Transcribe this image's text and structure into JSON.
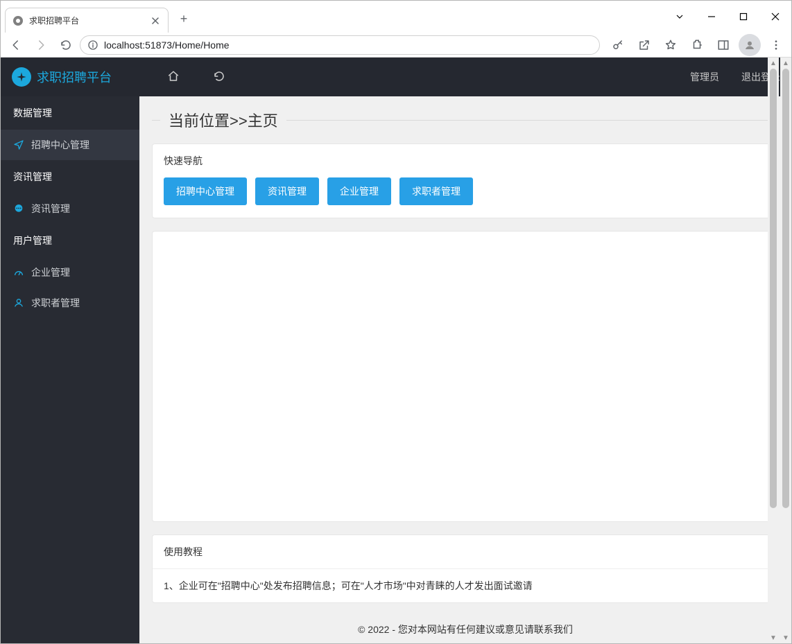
{
  "browser": {
    "tab_title": "求职招聘平台",
    "url": "localhost:51873/Home/Home"
  },
  "topbar": {
    "brand": "求职招聘平台",
    "user_label": "管理员",
    "logout_label": "退出登录"
  },
  "sidebar": {
    "sections": [
      {
        "title": "数据管理",
        "items": [
          {
            "label": "招聘中心管理",
            "active": true,
            "icon": "paper-plane-icon"
          }
        ]
      },
      {
        "title": "资讯管理",
        "items": [
          {
            "label": "资讯管理",
            "active": false,
            "icon": "chat-bubble-icon"
          }
        ]
      },
      {
        "title": "用户管理",
        "items": [
          {
            "label": "企业管理",
            "active": false,
            "icon": "gauge-icon"
          },
          {
            "label": "求职者管理",
            "active": false,
            "icon": "user-icon"
          }
        ]
      }
    ]
  },
  "main": {
    "breadcrumb": "当前位置>>主页",
    "quicknav": {
      "title": "快速导航",
      "buttons": [
        "招聘中心管理",
        "资讯管理",
        "企业管理",
        "求职者管理"
      ]
    },
    "tutorial": {
      "title": "使用教程",
      "line1": "1、企业可在\"招聘中心\"处发布招聘信息；可在\"人才市场\"中对青睐的人才发出面试邀请"
    }
  },
  "footer": {
    "text": "© 2022 - 您对本网站有任何建议或意见请联系我们"
  }
}
